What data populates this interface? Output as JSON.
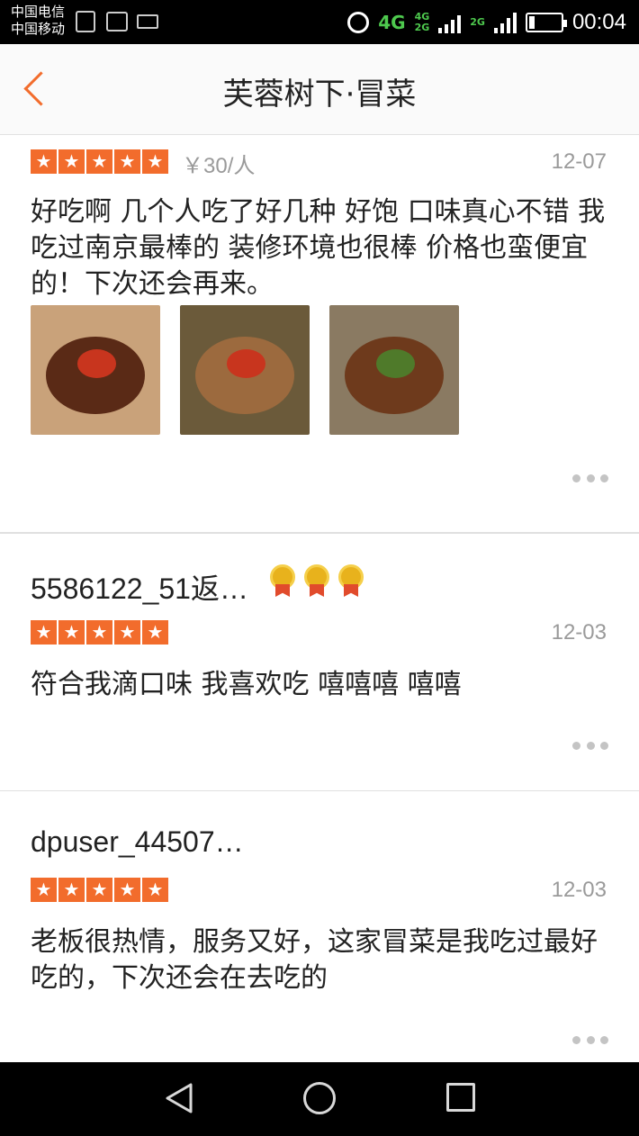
{
  "status_bar": {
    "carriers": [
      "中国电信",
      "中国移动"
    ],
    "network_4g": "4G",
    "network_small": [
      "4G",
      "2G"
    ],
    "network_2g": "2G",
    "time": "00:04"
  },
  "header": {
    "title": "芙蓉树下·冒菜"
  },
  "reviews": [
    {
      "rating": 5,
      "price": "￥30/人",
      "date": "12-07",
      "text": "好吃啊 几个人吃了好几种 好饱 口味真心不错 我吃过南京最棒的 装修环境也很棒 价格也蛮便宜的！下次还会再来。",
      "photo_count": 3
    },
    {
      "user": "5586122_51返…",
      "medals": 3,
      "rating": 5,
      "date": "12-03",
      "text": "符合我滴口味 我喜欢吃 嘻嘻嘻 嘻嘻"
    },
    {
      "user": "dpuser_44507…",
      "rating": 5,
      "date": "12-03",
      "text": "老板很热情，服务又好，这家冒菜是我吃过最好吃的，下次还会在去吃的"
    }
  ],
  "colors": {
    "accent": "#f26c2c",
    "star": "#f26c2c",
    "meta_text": "#9a9a9a"
  },
  "icons": {
    "back": "chevron-left-icon",
    "more": "more-dots-icon",
    "medal": "medal-icon",
    "star": "star-icon"
  }
}
